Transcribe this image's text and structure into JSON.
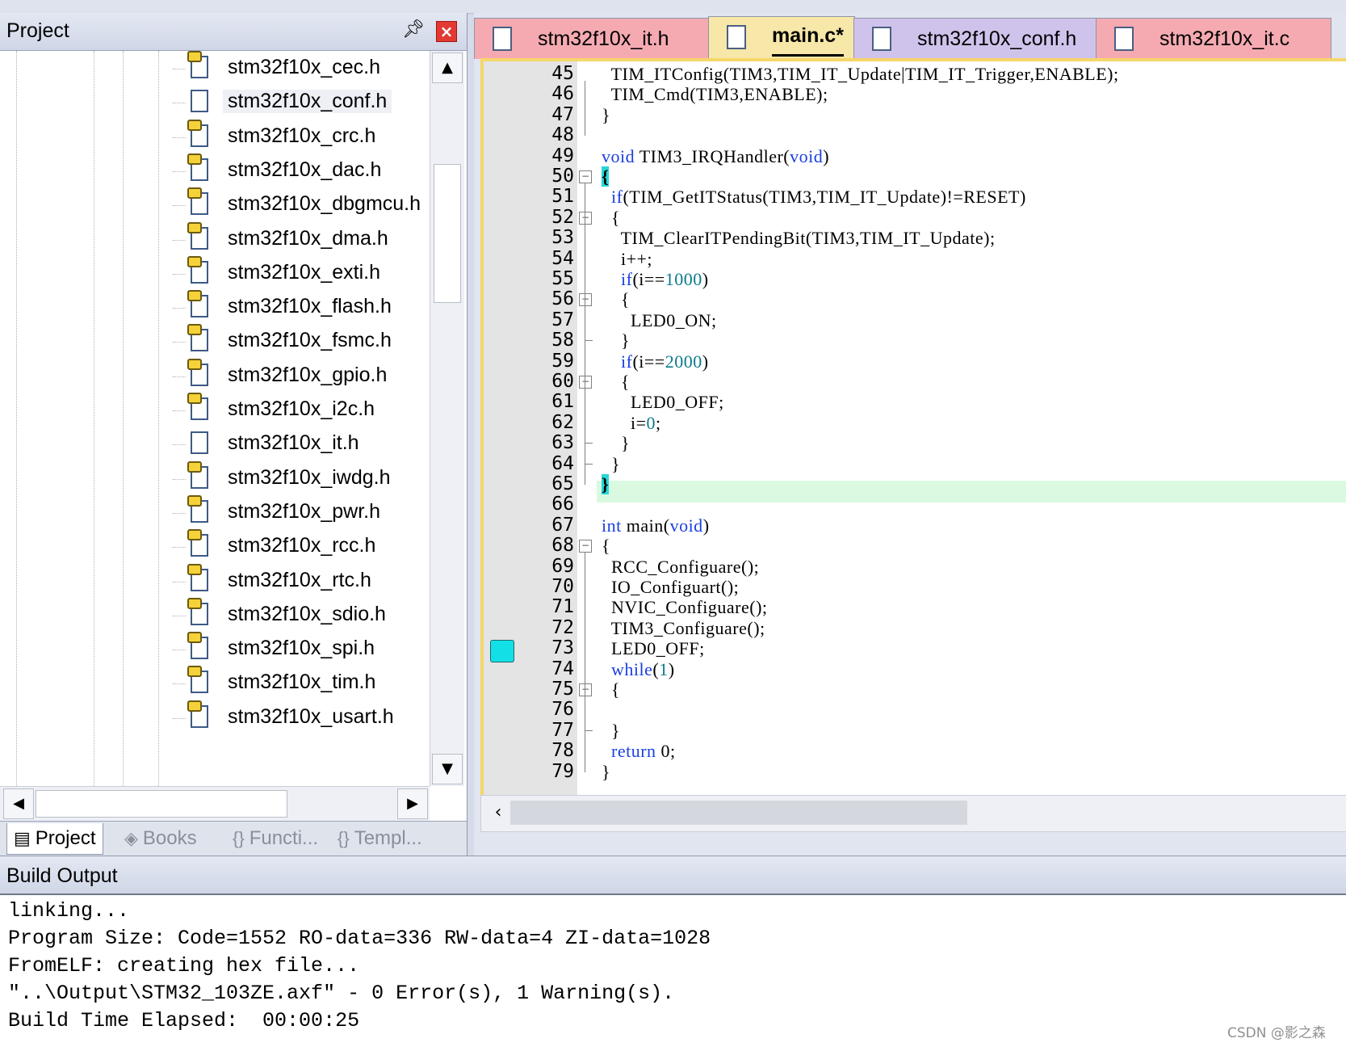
{
  "project_panel": {
    "title": "Project",
    "pin_icon": "pin-icon",
    "close_icon": "close-icon",
    "files": [
      {
        "label": "stm32f10x_cec.h",
        "icon": "header-file-key-icon"
      },
      {
        "label": "stm32f10x_conf.h",
        "icon": "header-file-icon"
      },
      {
        "label": "stm32f10x_crc.h",
        "icon": "header-file-key-icon"
      },
      {
        "label": "stm32f10x_dac.h",
        "icon": "header-file-key-icon"
      },
      {
        "label": "stm32f10x_dbgmcu.h",
        "icon": "header-file-key-icon"
      },
      {
        "label": "stm32f10x_dma.h",
        "icon": "header-file-key-icon"
      },
      {
        "label": "stm32f10x_exti.h",
        "icon": "header-file-key-icon"
      },
      {
        "label": "stm32f10x_flash.h",
        "icon": "header-file-key-icon"
      },
      {
        "label": "stm32f10x_fsmc.h",
        "icon": "header-file-key-icon"
      },
      {
        "label": "stm32f10x_gpio.h",
        "icon": "header-file-key-icon"
      },
      {
        "label": "stm32f10x_i2c.h",
        "icon": "header-file-key-icon"
      },
      {
        "label": "stm32f10x_it.h",
        "icon": "header-file-icon"
      },
      {
        "label": "stm32f10x_iwdg.h",
        "icon": "header-file-key-icon"
      },
      {
        "label": "stm32f10x_pwr.h",
        "icon": "header-file-key-icon"
      },
      {
        "label": "stm32f10x_rcc.h",
        "icon": "header-file-key-icon"
      },
      {
        "label": "stm32f10x_rtc.h",
        "icon": "header-file-key-icon"
      },
      {
        "label": "stm32f10x_sdio.h",
        "icon": "header-file-key-icon"
      },
      {
        "label": "stm32f10x_spi.h",
        "icon": "header-file-key-icon"
      },
      {
        "label": "stm32f10x_tim.h",
        "icon": "header-file-key-icon"
      },
      {
        "label": "stm32f10x_usart.h",
        "icon": "header-file-key-icon"
      }
    ],
    "bottom_tabs": [
      {
        "label": "Project",
        "icon": "project-icon",
        "glyph": "▤",
        "active": true
      },
      {
        "label": "Books",
        "icon": "books-icon",
        "glyph": "◈",
        "active": false
      },
      {
        "label": "Functi...",
        "icon": "functions-icon",
        "glyph": "{}",
        "active": false
      },
      {
        "label": "Templ...",
        "icon": "templates-icon",
        "glyph": "{}",
        "active": false
      }
    ]
  },
  "editor": {
    "tabs": [
      {
        "label": "stm32f10x_it.h",
        "color": "#f5aab2"
      },
      {
        "label": "main.c*",
        "color": "#f7e7a8",
        "active": true
      },
      {
        "label": "stm32f10x_conf.h",
        "color": "#cfc3ec"
      },
      {
        "label": "stm32f10x_it.c",
        "color": "#f5aab2"
      }
    ],
    "lines": [
      {
        "n": "45",
        "text": "  TIM_ITConfig(TIM3,TIM_IT_Update|TIM_IT_Trigger,ENABLE);"
      },
      {
        "n": "46",
        "text": "  TIM_Cmd(TIM3,ENABLE);"
      },
      {
        "n": "47",
        "text": "}"
      },
      {
        "n": "48",
        "text": ""
      },
      {
        "n": "49",
        "text": "void TIM3_IRQHandler(void)"
      },
      {
        "n": "50",
        "text": "{"
      },
      {
        "n": "51",
        "text": "  if(TIM_GetITStatus(TIM3,TIM_IT_Update)!=RESET)"
      },
      {
        "n": "52",
        "text": "  {"
      },
      {
        "n": "53",
        "text": "    TIM_ClearITPendingBit(TIM3,TIM_IT_Update);"
      },
      {
        "n": "54",
        "text": "    i++;"
      },
      {
        "n": "55",
        "text": "    if(i==1000)"
      },
      {
        "n": "56",
        "text": "    {"
      },
      {
        "n": "57",
        "text": "      LED0_ON;"
      },
      {
        "n": "58",
        "text": "    }"
      },
      {
        "n": "59",
        "text": "    if(i==2000)"
      },
      {
        "n": "60",
        "text": "    {"
      },
      {
        "n": "61",
        "text": "      LED0_OFF;"
      },
      {
        "n": "62",
        "text": "      i=0;"
      },
      {
        "n": "63",
        "text": "    }"
      },
      {
        "n": "64",
        "text": "  }"
      },
      {
        "n": "65",
        "text": "}"
      },
      {
        "n": "66",
        "text": ""
      },
      {
        "n": "67",
        "text": "int main(void)"
      },
      {
        "n": "68",
        "text": "{"
      },
      {
        "n": "69",
        "text": "  RCC_Configuare();"
      },
      {
        "n": "70",
        "text": "  IO_Configuart();"
      },
      {
        "n": "71",
        "text": "  NVIC_Configuare();"
      },
      {
        "n": "72",
        "text": "  TIM3_Configuare();"
      },
      {
        "n": "73",
        "text": "  LED0_OFF;"
      },
      {
        "n": "74",
        "text": "  while(1)"
      },
      {
        "n": "75",
        "text": "  {"
      },
      {
        "n": "76",
        "text": ""
      },
      {
        "n": "77",
        "text": "  }"
      },
      {
        "n": "78",
        "text": "  return 0;"
      },
      {
        "n": "79",
        "text": "}"
      }
    ],
    "current_line": "65",
    "bookmark_line": "73",
    "colors": {
      "keyword": "#1a40e0",
      "number": "#0a7a8c",
      "brace_highlight": "#26d7d7",
      "current_line": "#d9fae1",
      "bookmark": "#12e0e6"
    }
  },
  "build_output": {
    "title": "Build Output",
    "lines": [
      "linking...",
      "Program Size: Code=1552 RO-data=336 RW-data=4 ZI-data=1028",
      "FromELF: creating hex file...",
      "\"..\\Output\\STM32_103ZE.axf\" - 0 Error(s), 1 Warning(s).",
      "Build Time Elapsed:  00:00:25"
    ]
  },
  "watermark": "CSDN @影之森"
}
